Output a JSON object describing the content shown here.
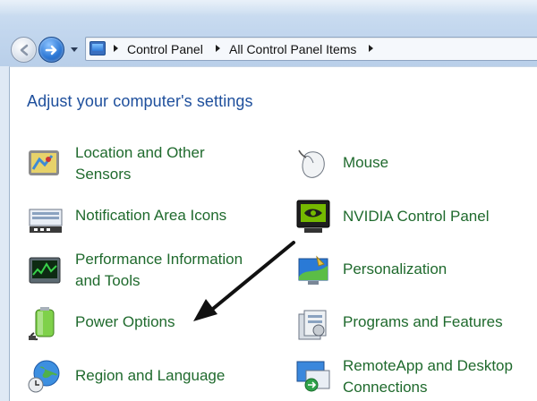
{
  "breadcrumb": {
    "items": [
      "Control Panel",
      "All Control Panel Items"
    ]
  },
  "pane": {
    "title": "Adjust your computer's settings"
  },
  "items": [
    {
      "label": "Location and Other Sensors",
      "line1": "Location and Other",
      "line2": "Sensors",
      "icon": "location-sensors-icon"
    },
    {
      "label": "Mouse",
      "line1": "Mouse",
      "icon": "mouse-icon"
    },
    {
      "label": "Notification Area Icons",
      "line1": "Notification Area Icons",
      "icon": "notification-area-icon"
    },
    {
      "label": "NVIDIA Control Panel",
      "line1": "NVIDIA Control Panel",
      "icon": "nvidia-icon"
    },
    {
      "label": "Performance Information and Tools",
      "line1": "Performance Information",
      "line2": "and Tools",
      "icon": "performance-icon"
    },
    {
      "label": "Personalization",
      "line1": "Personalization",
      "icon": "personalization-icon"
    },
    {
      "label": "Power Options",
      "line1": "Power Options",
      "icon": "power-options-icon"
    },
    {
      "label": "Programs and Features",
      "line1": "Programs and Features",
      "icon": "programs-features-icon"
    },
    {
      "label": "Region and Language",
      "line1": "Region and Language",
      "icon": "region-language-icon"
    },
    {
      "label": "RemoteApp and Desktop Connections",
      "line1": "RemoteApp and Desktop",
      "line2": "Connections",
      "icon": "remoteapp-icon"
    }
  ],
  "colors": {
    "link": "#1f6a2d",
    "title": "#1e4f9c",
    "chrome": "#c3d7ee"
  }
}
